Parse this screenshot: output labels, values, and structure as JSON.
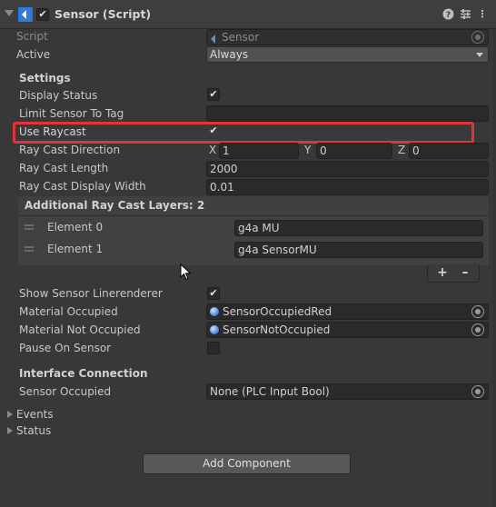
{
  "header": {
    "title": "Sensor (Script)",
    "enabled": true
  },
  "script": {
    "label": "Script",
    "value": "Sensor"
  },
  "active": {
    "label": "Active",
    "value": "Always"
  },
  "settings": {
    "section_title": "Settings",
    "display_status": {
      "label": "Display Status",
      "checked": true
    },
    "limit_sensor_to_tag": {
      "label": "Limit Sensor To Tag",
      "value": ""
    },
    "use_raycast": {
      "label": "Use Raycast",
      "checked": true
    },
    "ray_cast_direction": {
      "label": "Ray Cast Direction",
      "x_label": "X",
      "x": "1",
      "y_label": "Y",
      "y": "0",
      "z_label": "Z",
      "z": "0"
    },
    "ray_cast_length": {
      "label": "Ray Cast Length",
      "value": "2000"
    },
    "ray_cast_display_width": {
      "label": "Ray Cast Display Width",
      "value": "0.01"
    }
  },
  "layers": {
    "title": "Additional Ray Cast Layers: 2",
    "elements": [
      {
        "label": "Element 0",
        "value": "g4a MU"
      },
      {
        "label": "Element 1",
        "value": "g4a SensorMU"
      }
    ],
    "add": "+",
    "remove": "–"
  },
  "show_sensor_linerenderer": {
    "label": "Show Sensor Linerenderer",
    "checked": true
  },
  "material_occupied": {
    "label": "Material Occupied",
    "value": "SensorOccupiedRed"
  },
  "material_not_occupied": {
    "label": "Material Not Occupied",
    "value": "SensorNotOccupied"
  },
  "pause_on_sensor": {
    "label": "Pause On Sensor",
    "checked": false
  },
  "interface": {
    "section_title": "Interface Connection",
    "sensor_occupied": {
      "label": "Sensor Occupied",
      "value": "None (PLC Input Bool)"
    }
  },
  "foldouts": {
    "events": "Events",
    "status": "Status"
  },
  "add_component": "Add Component",
  "colors": {
    "highlight": "#e0363a",
    "script_icon": "#2f7bd8"
  }
}
